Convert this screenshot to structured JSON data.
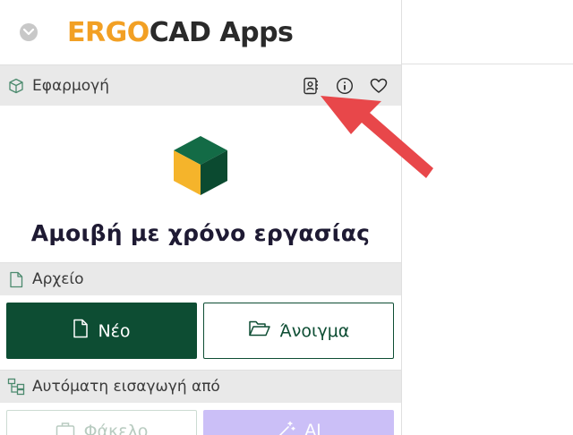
{
  "header": {
    "logo_part1": "ERGO",
    "logo_part2": "CAD",
    "logo_part3": "Apps",
    "collapse_icon": "chevron-down-icon"
  },
  "application_section": {
    "label": "Εφαρμογή",
    "icon": "cube-icon",
    "actions": [
      {
        "name": "contact-book-icon"
      },
      {
        "name": "info-icon"
      },
      {
        "name": "heart-icon"
      }
    ],
    "app_title": "Αμοιβή με χρόνο εργασίας"
  },
  "file_section": {
    "label": "Αρχείο",
    "icon": "file-icon",
    "new_label": "Νέο",
    "open_label": "Άνοιγμα"
  },
  "import_section": {
    "label": "Αυτόματη εισαγωγή από",
    "icon": "hierarchy-icon",
    "folder_label": "Φάκελο",
    "ai_label": "AI"
  },
  "colors": {
    "accent_green": "#0d4d33",
    "logo_orange": "#f2a024",
    "arrow_red": "#e8474a",
    "ai_purple": "#cbbff7"
  }
}
